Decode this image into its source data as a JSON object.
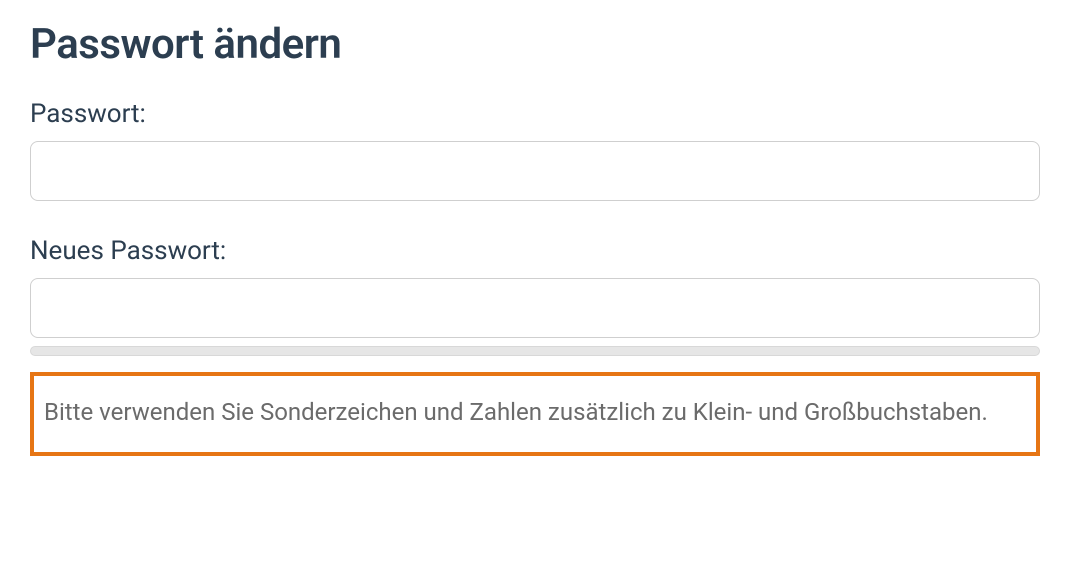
{
  "title": "Passwort ändern",
  "fields": {
    "current": {
      "label": "Passwort:",
      "value": ""
    },
    "new": {
      "label": "Neues Passwort:",
      "value": ""
    }
  },
  "hint": "Bitte verwenden Sie Sonderzeichen und Zahlen zusätzlich zu Klein- und Großbuchstaben.",
  "colors": {
    "hint_border": "#e67514",
    "text_primary": "#2c3e50",
    "text_muted": "#6b6b6b"
  }
}
